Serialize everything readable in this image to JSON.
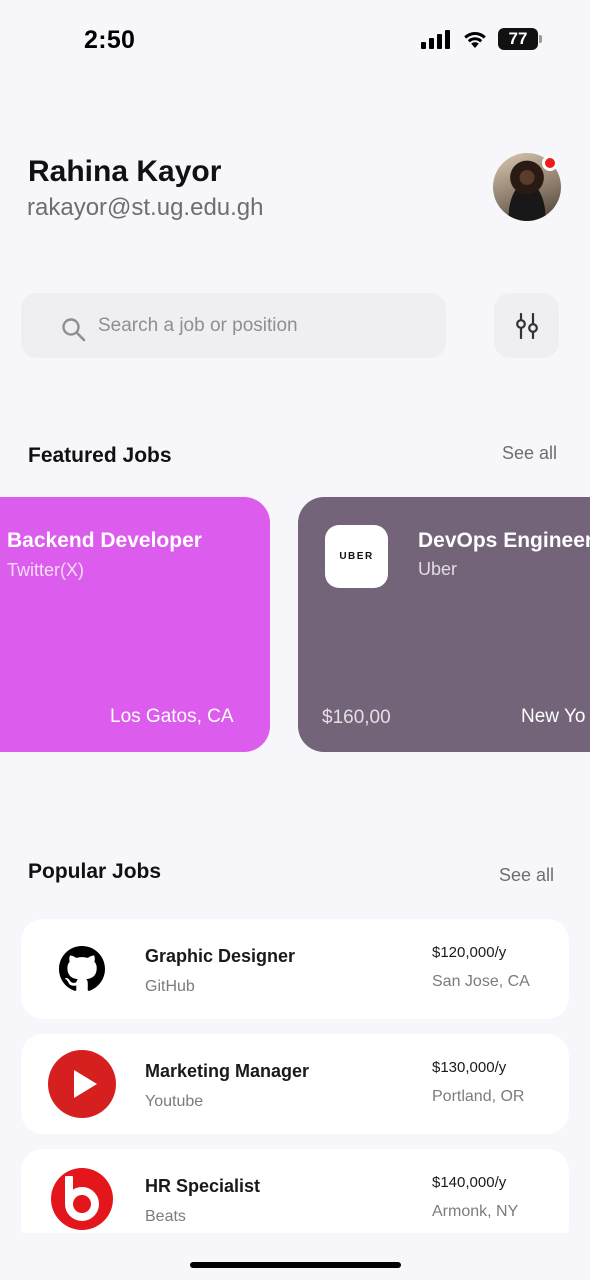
{
  "status_bar": {
    "time": "2:50",
    "battery": "77"
  },
  "user": {
    "name": "Rahina Kayor",
    "email": "rakayor@st.ug.edu.gh"
  },
  "search": {
    "placeholder": "Search a job or position"
  },
  "featured": {
    "title": "Featured Jobs",
    "see_all": "See all",
    "cards": [
      {
        "title": "Backend Developer",
        "company": "Twitter(X)",
        "location": "Los Gatos, CA",
        "color": "#dc5ded"
      },
      {
        "title": "DevOps Engineer",
        "company": "Uber",
        "salary": "$160,00",
        "location": "New Yo",
        "logo_text": "UBER",
        "color": "#736479"
      }
    ]
  },
  "popular": {
    "title": "Popular Jobs",
    "see_all": "See all",
    "jobs": [
      {
        "title": "Graphic Designer",
        "company": "GitHub",
        "salary": "$120,000/y",
        "location": "San Jose, CA",
        "icon": "github-icon"
      },
      {
        "title": "Marketing Manager",
        "company": "Youtube",
        "salary": "$130,000/y",
        "location": "Portland, OR",
        "icon": "youtube-icon"
      },
      {
        "title": "HR Specialist",
        "company": "Beats",
        "salary": "$140,000/y",
        "location": "Armonk, NY",
        "icon": "beats-icon"
      }
    ]
  },
  "colors": {
    "background": "#f7f7fb",
    "notification": "#ee1c1c",
    "youtube": "#d61f1f",
    "beats": "#e3161c"
  }
}
